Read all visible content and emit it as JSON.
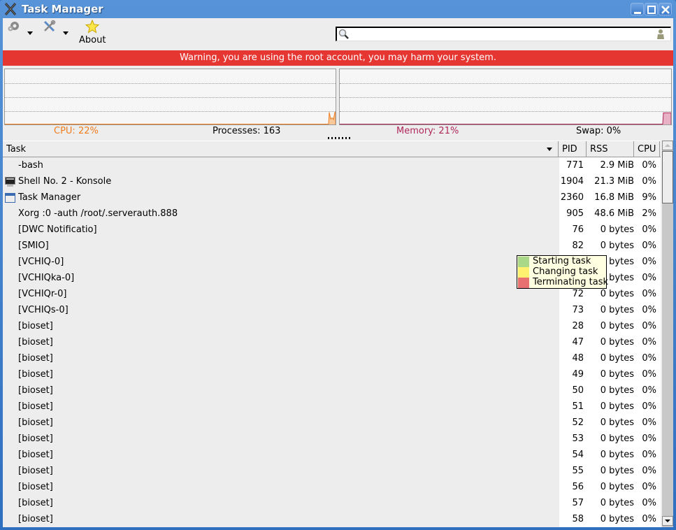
{
  "window": {
    "title": "Task Manager",
    "controls": [
      "minimize",
      "maximize",
      "close"
    ]
  },
  "toolbar": {
    "settings_icon": "gear-icon",
    "tools_icon": "tools-icon",
    "about_icon": "star-icon",
    "about_label": "About"
  },
  "search": {
    "value": "",
    "placeholder": "",
    "search_icon": "search-icon",
    "filter_icon": "user-filter-icon"
  },
  "warning": "Warning, you are using the root account, you may harm your system.",
  "monitors": {
    "cpu_label": "CPU: 22%",
    "cpu_color": "#f07d1e",
    "processes_label": "Processes: 163",
    "memory_label": "Memory: 21%",
    "memory_color": "#b0285a",
    "swap_label": "Swap: 0%",
    "cpu_history_percent": [
      22,
      10,
      12,
      9,
      22
    ],
    "memory_history_percent": [
      21,
      21
    ]
  },
  "columns": {
    "task": "Task",
    "pid": "PID",
    "rss": "RSS",
    "cpu": "CPU"
  },
  "rows": [
    {
      "task": "-bash",
      "icon": "",
      "pid": "771",
      "rss": "2.9 MiB",
      "cpu": "0%"
    },
    {
      "task": "Shell No. 2 - Konsole",
      "icon": "terminal-icon",
      "pid": "1904",
      "rss": "21.3 MiB",
      "cpu": "0%"
    },
    {
      "task": "Task Manager",
      "icon": "window-icon",
      "pid": "2360",
      "rss": "16.8 MiB",
      "cpu": "9%"
    },
    {
      "task": "Xorg :0 -auth /root/.serverauth.888",
      "icon": "",
      "pid": "905",
      "rss": "48.6 MiB",
      "cpu": "2%"
    },
    {
      "task": "[DWC Notificatio]",
      "icon": "",
      "pid": "76",
      "rss": "0 bytes",
      "cpu": "0%"
    },
    {
      "task": "[SMIO]",
      "icon": "",
      "pid": "82",
      "rss": "0 bytes",
      "cpu": "0%"
    },
    {
      "task": "[VCHIQ-0]",
      "icon": "",
      "pid": "",
      "rss": "0 bytes",
      "cpu": "0%"
    },
    {
      "task": "[VCHIQka-0]",
      "icon": "",
      "pid": "",
      "rss": "0 bytes",
      "cpu": "0%"
    },
    {
      "task": "[VCHIQr-0]",
      "icon": "",
      "pid": "72",
      "rss": "0 bytes",
      "cpu": "0%"
    },
    {
      "task": "[VCHIQs-0]",
      "icon": "",
      "pid": "73",
      "rss": "0 bytes",
      "cpu": "0%"
    },
    {
      "task": "[bioset]",
      "icon": "",
      "pid": "28",
      "rss": "0 bytes",
      "cpu": "0%"
    },
    {
      "task": "[bioset]",
      "icon": "",
      "pid": "47",
      "rss": "0 bytes",
      "cpu": "0%"
    },
    {
      "task": "[bioset]",
      "icon": "",
      "pid": "48",
      "rss": "0 bytes",
      "cpu": "0%"
    },
    {
      "task": "[bioset]",
      "icon": "",
      "pid": "49",
      "rss": "0 bytes",
      "cpu": "0%"
    },
    {
      "task": "[bioset]",
      "icon": "",
      "pid": "50",
      "rss": "0 bytes",
      "cpu": "0%"
    },
    {
      "task": "[bioset]",
      "icon": "",
      "pid": "51",
      "rss": "0 bytes",
      "cpu": "0%"
    },
    {
      "task": "[bioset]",
      "icon": "",
      "pid": "52",
      "rss": "0 bytes",
      "cpu": "0%"
    },
    {
      "task": "[bioset]",
      "icon": "",
      "pid": "53",
      "rss": "0 bytes",
      "cpu": "0%"
    },
    {
      "task": "[bioset]",
      "icon": "",
      "pid": "54",
      "rss": "0 bytes",
      "cpu": "0%"
    },
    {
      "task": "[bioset]",
      "icon": "",
      "pid": "55",
      "rss": "0 bytes",
      "cpu": "0%"
    },
    {
      "task": "[bioset]",
      "icon": "",
      "pid": "56",
      "rss": "0 bytes",
      "cpu": "0%"
    },
    {
      "task": "[bioset]",
      "icon": "",
      "pid": "57",
      "rss": "0 bytes",
      "cpu": "0%"
    },
    {
      "task": "[bioset]",
      "icon": "",
      "pid": "58",
      "rss": "0 bytes",
      "cpu": "0%"
    }
  ],
  "legend_tooltip": [
    {
      "label": "Starting task",
      "color": "#a8d888"
    },
    {
      "label": "Changing task",
      "color": "#fff070"
    },
    {
      "label": "Terminating task",
      "color": "#e87070"
    }
  ]
}
